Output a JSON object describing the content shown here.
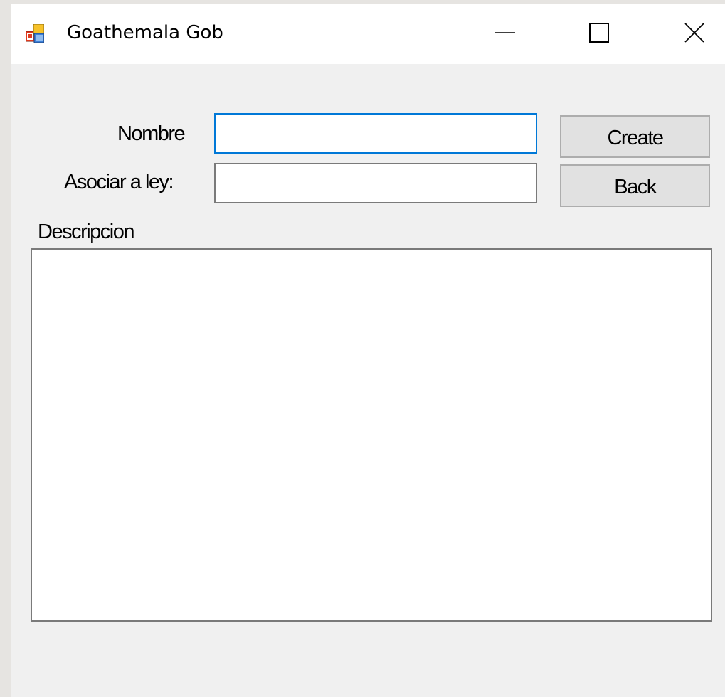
{
  "window": {
    "title": "Goathemala Gob",
    "app_icon": "windows-form-icon",
    "controls": {
      "minimize_icon": "minimize-icon",
      "maximize_icon": "maximize-icon",
      "close_icon": "close-icon"
    }
  },
  "form": {
    "nombre": {
      "label": "Nombre",
      "value": "",
      "focused": true
    },
    "asociar": {
      "label": "Asociar a ley:",
      "value": ""
    },
    "descripcion": {
      "label": "Descripcion",
      "value": ""
    },
    "buttons": {
      "create_label": "Create",
      "back_label": "Back"
    }
  },
  "colors": {
    "focus_border": "#0078d7",
    "button_face": "#e1e1e1",
    "window_bg": "#f0f0f0"
  }
}
